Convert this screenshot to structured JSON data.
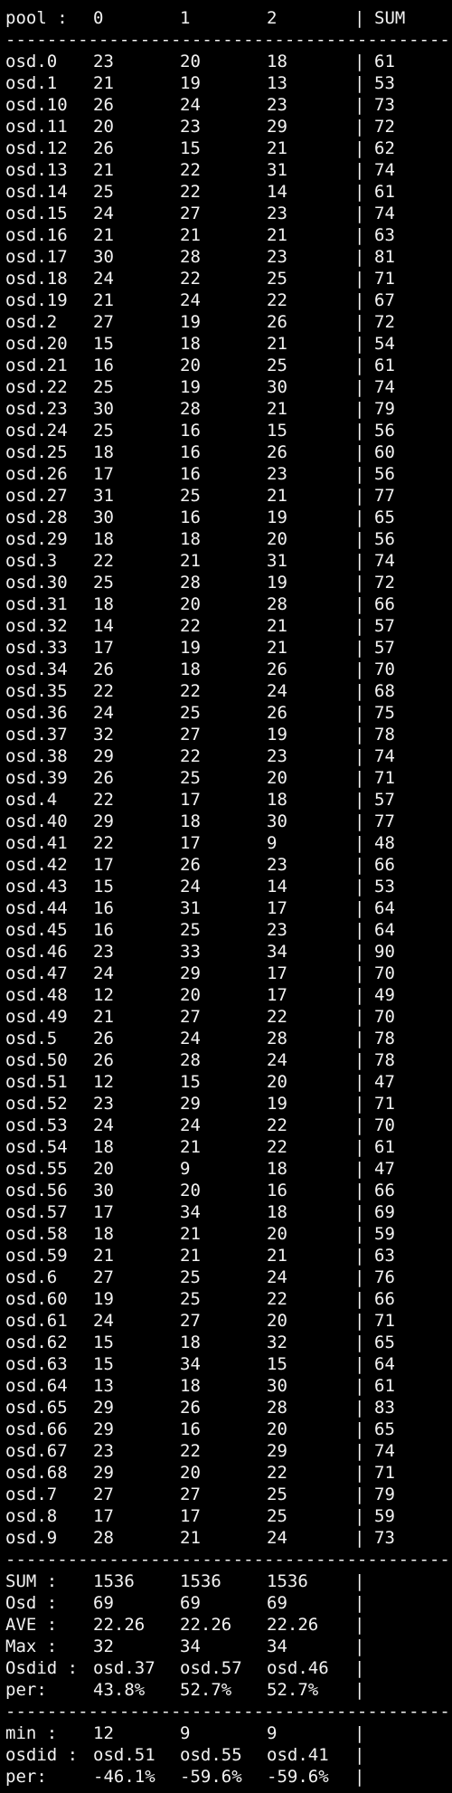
{
  "header": {
    "pool": "pool :",
    "c0": "0",
    "c1": "1",
    "c2": "2",
    "bar": "|",
    "sum": "SUM"
  },
  "separator": "--------------------------------------------",
  "rows": [
    [
      "osd.0",
      "23",
      "20",
      "18",
      "|",
      "61"
    ],
    [
      "osd.1",
      "21",
      "19",
      "13",
      "|",
      "53"
    ],
    [
      "osd.10",
      "26",
      "24",
      "23",
      "|",
      "73"
    ],
    [
      "osd.11",
      "20",
      "23",
      "29",
      "|",
      "72"
    ],
    [
      "osd.12",
      "26",
      "15",
      "21",
      "|",
      "62"
    ],
    [
      "osd.13",
      "21",
      "22",
      "31",
      "|",
      "74"
    ],
    [
      "osd.14",
      "25",
      "22",
      "14",
      "|",
      "61"
    ],
    [
      "osd.15",
      "24",
      "27",
      "23",
      "|",
      "74"
    ],
    [
      "osd.16",
      "21",
      "21",
      "21",
      "|",
      "63"
    ],
    [
      "osd.17",
      "30",
      "28",
      "23",
      "|",
      "81"
    ],
    [
      "osd.18",
      "24",
      "22",
      "25",
      "|",
      "71"
    ],
    [
      "osd.19",
      "21",
      "24",
      "22",
      "|",
      "67"
    ],
    [
      "osd.2",
      "27",
      "19",
      "26",
      "|",
      "72"
    ],
    [
      "osd.20",
      "15",
      "18",
      "21",
      "|",
      "54"
    ],
    [
      "osd.21",
      "16",
      "20",
      "25",
      "|",
      "61"
    ],
    [
      "osd.22",
      "25",
      "19",
      "30",
      "|",
      "74"
    ],
    [
      "osd.23",
      "30",
      "28",
      "21",
      "|",
      "79"
    ],
    [
      "osd.24",
      "25",
      "16",
      "15",
      "|",
      "56"
    ],
    [
      "osd.25",
      "18",
      "16",
      "26",
      "|",
      "60"
    ],
    [
      "osd.26",
      "17",
      "16",
      "23",
      "|",
      "56"
    ],
    [
      "osd.27",
      "31",
      "25",
      "21",
      "|",
      "77"
    ],
    [
      "osd.28",
      "30",
      "16",
      "19",
      "|",
      "65"
    ],
    [
      "osd.29",
      "18",
      "18",
      "20",
      "|",
      "56"
    ],
    [
      "osd.3",
      "22",
      "21",
      "31",
      "|",
      "74"
    ],
    [
      "osd.30",
      "25",
      "28",
      "19",
      "|",
      "72"
    ],
    [
      "osd.31",
      "18",
      "20",
      "28",
      "|",
      "66"
    ],
    [
      "osd.32",
      "14",
      "22",
      "21",
      "|",
      "57"
    ],
    [
      "osd.33",
      "17",
      "19",
      "21",
      "|",
      "57"
    ],
    [
      "osd.34",
      "26",
      "18",
      "26",
      "|",
      "70"
    ],
    [
      "osd.35",
      "22",
      "22",
      "24",
      "|",
      "68"
    ],
    [
      "osd.36",
      "24",
      "25",
      "26",
      "|",
      "75"
    ],
    [
      "osd.37",
      "32",
      "27",
      "19",
      "|",
      "78"
    ],
    [
      "osd.38",
      "29",
      "22",
      "23",
      "|",
      "74"
    ],
    [
      "osd.39",
      "26",
      "25",
      "20",
      "|",
      "71"
    ],
    [
      "osd.4",
      "22",
      "17",
      "18",
      "|",
      "57"
    ],
    [
      "osd.40",
      "29",
      "18",
      "30",
      "|",
      "77"
    ],
    [
      "osd.41",
      "22",
      "17",
      "9",
      "|",
      "48"
    ],
    [
      "osd.42",
      "17",
      "26",
      "23",
      "|",
      "66"
    ],
    [
      "osd.43",
      "15",
      "24",
      "14",
      "|",
      "53"
    ],
    [
      "osd.44",
      "16",
      "31",
      "17",
      "|",
      "64"
    ],
    [
      "osd.45",
      "16",
      "25",
      "23",
      "|",
      "64"
    ],
    [
      "osd.46",
      "23",
      "33",
      "34",
      "|",
      "90"
    ],
    [
      "osd.47",
      "24",
      "29",
      "17",
      "|",
      "70"
    ],
    [
      "osd.48",
      "12",
      "20",
      "17",
      "|",
      "49"
    ],
    [
      "osd.49",
      "21",
      "27",
      "22",
      "|",
      "70"
    ],
    [
      "osd.5",
      "26",
      "24",
      "28",
      "|",
      "78"
    ],
    [
      "osd.50",
      "26",
      "28",
      "24",
      "|",
      "78"
    ],
    [
      "osd.51",
      "12",
      "15",
      "20",
      "|",
      "47"
    ],
    [
      "osd.52",
      "23",
      "29",
      "19",
      "|",
      "71"
    ],
    [
      "osd.53",
      "24",
      "24",
      "22",
      "|",
      "70"
    ],
    [
      "osd.54",
      "18",
      "21",
      "22",
      "|",
      "61"
    ],
    [
      "osd.55",
      "20",
      "9",
      "18",
      "|",
      "47"
    ],
    [
      "osd.56",
      "30",
      "20",
      "16",
      "|",
      "66"
    ],
    [
      "osd.57",
      "17",
      "34",
      "18",
      "|",
      "69"
    ],
    [
      "osd.58",
      "18",
      "21",
      "20",
      "|",
      "59"
    ],
    [
      "osd.59",
      "21",
      "21",
      "21",
      "|",
      "63"
    ],
    [
      "osd.6",
      "27",
      "25",
      "24",
      "|",
      "76"
    ],
    [
      "osd.60",
      "19",
      "25",
      "22",
      "|",
      "66"
    ],
    [
      "osd.61",
      "24",
      "27",
      "20",
      "|",
      "71"
    ],
    [
      "osd.62",
      "15",
      "18",
      "32",
      "|",
      "65"
    ],
    [
      "osd.63",
      "15",
      "34",
      "15",
      "|",
      "64"
    ],
    [
      "osd.64",
      "13",
      "18",
      "30",
      "|",
      "61"
    ],
    [
      "osd.65",
      "29",
      "26",
      "28",
      "|",
      "83"
    ],
    [
      "osd.66",
      "29",
      "16",
      "20",
      "|",
      "65"
    ],
    [
      "osd.67",
      "23",
      "22",
      "29",
      "|",
      "74"
    ],
    [
      "osd.68",
      "29",
      "20",
      "22",
      "|",
      "71"
    ],
    [
      "osd.7",
      "27",
      "27",
      "25",
      "|",
      "79"
    ],
    [
      "osd.8",
      "17",
      "17",
      "25",
      "|",
      "59"
    ],
    [
      "osd.9",
      "28",
      "21",
      "24",
      "|",
      "73"
    ]
  ],
  "summary1": [
    [
      "SUM :",
      "1536",
      "1536",
      "1536",
      "|"
    ],
    [
      "Osd :",
      "69",
      "69",
      "69",
      "|"
    ],
    [
      "AVE :",
      "22.26",
      "22.26",
      "22.26",
      "|"
    ],
    [
      "Max :",
      "32",
      "34",
      "34",
      "|"
    ],
    [
      "Osdid :",
      "osd.37",
      "osd.57",
      "osd.46",
      "|"
    ],
    [
      "per:",
      "43.8%",
      "52.7%",
      "52.7%",
      "|"
    ]
  ],
  "summary2": [
    [
      "min :",
      "12",
      "9",
      "9",
      "|"
    ],
    [
      "osdid :",
      "osd.51",
      "osd.55",
      "osd.41",
      "|"
    ],
    [
      "per:",
      "-46.1%",
      "-59.6%",
      "-59.6%",
      "|"
    ]
  ]
}
